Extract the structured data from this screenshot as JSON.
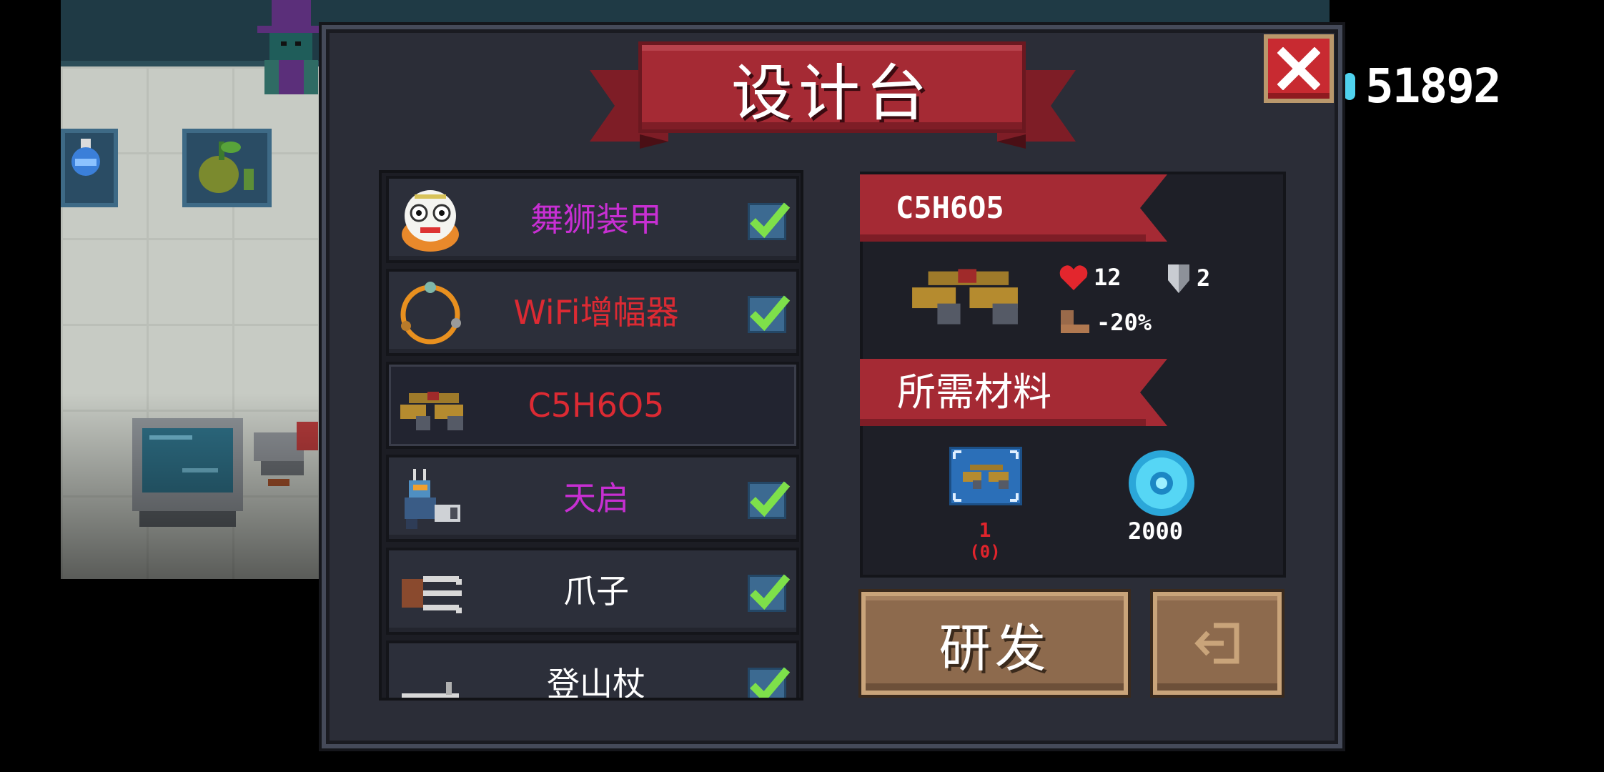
{
  "title": "设计台",
  "coins": "51892",
  "items": [
    {
      "name": "舞狮装甲",
      "color": "#c72fd2",
      "checked": true
    },
    {
      "name": "WiFi增幅器",
      "color": "#dc2a33",
      "checked": true
    },
    {
      "name": "C5H6O5",
      "color": "#dc2a33",
      "checked": false
    },
    {
      "name": "天启",
      "color": "#c72fd2",
      "checked": true
    },
    {
      "name": "爪子",
      "color": "#ffffff",
      "checked": true
    },
    {
      "name": "登山杖",
      "color": "#ffffff",
      "checked": true
    }
  ],
  "detail": {
    "name": "C5H6O5",
    "hp": "12",
    "armor": "2",
    "speed": "-20%",
    "materials_label": "所需材料",
    "material_required": "1",
    "material_owned": "(0)",
    "gem_cost": "2000"
  },
  "buttons": {
    "research": "研发"
  },
  "colors": {
    "banner_red": "#a52a34",
    "panel": "#2b2d37",
    "wood": "#8d6a4d",
    "check_green": "#7ee04a"
  }
}
